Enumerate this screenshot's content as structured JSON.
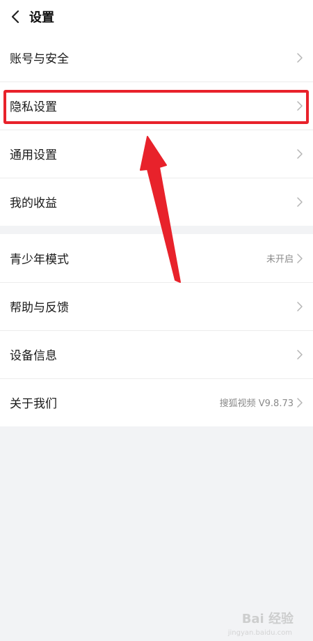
{
  "header": {
    "title": "设置"
  },
  "groups": [
    {
      "items": [
        {
          "label": "账号与安全",
          "value": ""
        },
        {
          "label": "隐私设置",
          "value": ""
        },
        {
          "label": "通用设置",
          "value": ""
        },
        {
          "label": "我的收益",
          "value": ""
        }
      ]
    },
    {
      "items": [
        {
          "label": "青少年模式",
          "value": "未开启"
        },
        {
          "label": "帮助与反馈",
          "value": ""
        },
        {
          "label": "设备信息",
          "value": ""
        },
        {
          "label": "关于我们",
          "value": "搜狐视频 V9.8.73"
        }
      ]
    }
  ],
  "annotation": {
    "color": "#e8222b"
  },
  "watermark": {
    "text": "Bai 经验",
    "sub": "jingyan.baidu.com"
  }
}
